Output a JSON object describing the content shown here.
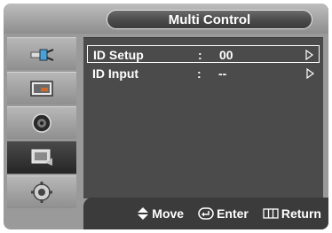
{
  "menu": {
    "title": "Multi Control"
  },
  "sidebar": {
    "items": [
      {
        "icon": "plug-icon"
      },
      {
        "icon": "picture-icon"
      },
      {
        "icon": "speaker-icon"
      },
      {
        "icon": "screen-icon",
        "active": true
      },
      {
        "icon": "gear-icon"
      }
    ]
  },
  "rows": [
    {
      "label": "ID Setup",
      "colon": ":",
      "value": "00",
      "selected": true
    },
    {
      "label": "ID Input",
      "colon": ":",
      "value": "--",
      "selected": false
    }
  ],
  "footer": {
    "move_label": "Move",
    "enter_label": "Enter",
    "return_label": "Return"
  },
  "colors": {
    "selected_outline": "#ffffff",
    "active_tab": "#262626"
  }
}
